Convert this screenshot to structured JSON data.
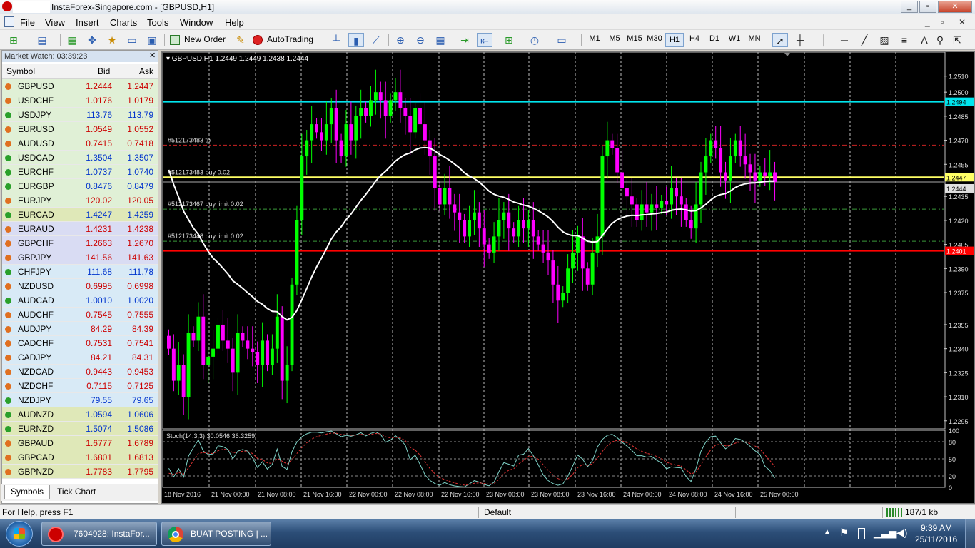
{
  "window": {
    "title": "InstaForex-Singapore.com - [GBPUSD,H1]"
  },
  "menu": [
    "File",
    "View",
    "Insert",
    "Charts",
    "Tools",
    "Window",
    "Help"
  ],
  "toolbar": {
    "new_order": "New Order",
    "autotrading": "AutoTrading",
    "timeframes": [
      "M1",
      "M5",
      "M15",
      "M30",
      "H1",
      "H4",
      "D1",
      "W1",
      "MN"
    ],
    "active_tf": "H1",
    "text_tool": "A"
  },
  "market_watch": {
    "title": "Market Watch: 03:39:23",
    "col_symbol": "Symbol",
    "col_bid": "Bid",
    "col_ask": "Ask",
    "rows": [
      {
        "symbol": "GBPUSD",
        "bid": "1.2444",
        "ask": "1.2447",
        "dir": "down",
        "color": "#cc0000",
        "bg": "#e0f0d6"
      },
      {
        "symbol": "USDCHF",
        "bid": "1.0176",
        "ask": "1.0179",
        "dir": "down",
        "color": "#cc0000",
        "bg": "#e0f0d6"
      },
      {
        "symbol": "USDJPY",
        "bid": "113.76",
        "ask": "113.79",
        "dir": "up",
        "color": "#0033cc",
        "bg": "#e0f0d6"
      },
      {
        "symbol": "EURUSD",
        "bid": "1.0549",
        "ask": "1.0552",
        "dir": "down",
        "color": "#cc0000",
        "bg": "#e0f0d6"
      },
      {
        "symbol": "AUDUSD",
        "bid": "0.7415",
        "ask": "0.7418",
        "dir": "down",
        "color": "#cc0000",
        "bg": "#e0f0d6"
      },
      {
        "symbol": "USDCAD",
        "bid": "1.3504",
        "ask": "1.3507",
        "dir": "up",
        "color": "#0033cc",
        "bg": "#e0f0d6"
      },
      {
        "symbol": "EURCHF",
        "bid": "1.0737",
        "ask": "1.0740",
        "dir": "up",
        "color": "#0033cc",
        "bg": "#e0f0d6"
      },
      {
        "symbol": "EURGBP",
        "bid": "0.8476",
        "ask": "0.8479",
        "dir": "up",
        "color": "#0033cc",
        "bg": "#e0f0d6"
      },
      {
        "symbol": "EURJPY",
        "bid": "120.02",
        "ask": "120.05",
        "dir": "down",
        "color": "#cc0000",
        "bg": "#e0f0d6"
      },
      {
        "symbol": "EURCAD",
        "bid": "1.4247",
        "ask": "1.4259",
        "dir": "up",
        "color": "#0033cc",
        "bg": "#dfe8b8"
      },
      {
        "symbol": "EURAUD",
        "bid": "1.4231",
        "ask": "1.4238",
        "dir": "down",
        "color": "#cc0000",
        "bg": "#d9dcf3"
      },
      {
        "symbol": "GBPCHF",
        "bid": "1.2663",
        "ask": "1.2670",
        "dir": "down",
        "color": "#cc0000",
        "bg": "#d9dcf3"
      },
      {
        "symbol": "GBPJPY",
        "bid": "141.56",
        "ask": "141.63",
        "dir": "down",
        "color": "#cc0000",
        "bg": "#d9dcf3"
      },
      {
        "symbol": "CHFJPY",
        "bid": "111.68",
        "ask": "111.78",
        "dir": "up",
        "color": "#0033cc",
        "bg": "#d8eaf6"
      },
      {
        "symbol": "NZDUSD",
        "bid": "0.6995",
        "ask": "0.6998",
        "dir": "down",
        "color": "#cc0000",
        "bg": "#d8eaf6"
      },
      {
        "symbol": "AUDCAD",
        "bid": "1.0010",
        "ask": "1.0020",
        "dir": "up",
        "color": "#0033cc",
        "bg": "#d8eaf6"
      },
      {
        "symbol": "AUDCHF",
        "bid": "0.7545",
        "ask": "0.7555",
        "dir": "down",
        "color": "#cc0000",
        "bg": "#d8eaf6"
      },
      {
        "symbol": "AUDJPY",
        "bid": "84.29",
        "ask": "84.39",
        "dir": "down",
        "color": "#cc0000",
        "bg": "#d8eaf6"
      },
      {
        "symbol": "CADCHF",
        "bid": "0.7531",
        "ask": "0.7541",
        "dir": "down",
        "color": "#cc0000",
        "bg": "#d8eaf6"
      },
      {
        "symbol": "CADJPY",
        "bid": "84.21",
        "ask": "84.31",
        "dir": "down",
        "color": "#cc0000",
        "bg": "#d8eaf6"
      },
      {
        "symbol": "NZDCAD",
        "bid": "0.9443",
        "ask": "0.9453",
        "dir": "down",
        "color": "#cc0000",
        "bg": "#d8eaf6"
      },
      {
        "symbol": "NZDCHF",
        "bid": "0.7115",
        "ask": "0.7125",
        "dir": "down",
        "color": "#cc0000",
        "bg": "#d8eaf6"
      },
      {
        "symbol": "NZDJPY",
        "bid": "79.55",
        "ask": "79.65",
        "dir": "up",
        "color": "#0033cc",
        "bg": "#d8eaf6"
      },
      {
        "symbol": "AUDNZD",
        "bid": "1.0594",
        "ask": "1.0606",
        "dir": "up",
        "color": "#0033cc",
        "bg": "#dfe8b8"
      },
      {
        "symbol": "EURNZD",
        "bid": "1.5074",
        "ask": "1.5086",
        "dir": "up",
        "color": "#0033cc",
        "bg": "#dfe8b8"
      },
      {
        "symbol": "GBPAUD",
        "bid": "1.6777",
        "ask": "1.6789",
        "dir": "down",
        "color": "#cc0000",
        "bg": "#dfe8b8"
      },
      {
        "symbol": "GBPCAD",
        "bid": "1.6801",
        "ask": "1.6813",
        "dir": "down",
        "color": "#cc0000",
        "bg": "#dfe8b8"
      },
      {
        "symbol": "GBPNZD",
        "bid": "1.7783",
        "ask": "1.7795",
        "dir": "down",
        "color": "#cc0000",
        "bg": "#dfe8b8"
      }
    ],
    "tab_symbols": "Symbols",
    "tab_tick": "Tick Chart"
  },
  "chart": {
    "header": "GBPUSD,H1  1.2449 1.2449 1.2438 1.2444",
    "ylim": [
      1.229,
      1.2525
    ],
    "price_ticks": [
      "1.2510",
      "1.2500",
      "1.2485",
      "1.2470",
      "1.2455",
      "1.2435",
      "1.2420",
      "1.2405",
      "1.2390",
      "1.2375",
      "1.2355",
      "1.2340",
      "1.2325",
      "1.2310",
      "1.2295"
    ],
    "hline_cyan": {
      "price": 1.2494,
      "label": "1.2494"
    },
    "hline_red": {
      "price": 1.2401,
      "label": "1.2401"
    },
    "ask_line": {
      "price": 1.2447,
      "label": "1.2447"
    },
    "bid_line": {
      "price": 1.2444,
      "label": "1.2444"
    },
    "orders": [
      {
        "label": "#512173483 tp",
        "price": 1.2467
      },
      {
        "label": "#512173483 buy 0.02",
        "price": 1.2447
      },
      {
        "label": "#512173467 buy limit 0.02",
        "price": 1.2427
      },
      {
        "label": "#512173448 buy limit 0.02",
        "price": 1.2407
      }
    ],
    "time_labels": [
      "18 Nov 2016",
      "21 Nov 00:00",
      "21 Nov 08:00",
      "21 Nov 16:00",
      "22 Nov 00:00",
      "22 Nov 08:00",
      "22 Nov 16:00",
      "23 Nov 00:00",
      "23 Nov 08:00",
      "23 Nov 16:00",
      "24 Nov 00:00",
      "24 Nov 08:00",
      "24 Nov 16:00",
      "25 Nov 00:00"
    ],
    "indicator": {
      "label": "Stoch(14,3,3) 30.0546 36.3259",
      "levels": [
        "100",
        "80",
        "50",
        "20",
        "0"
      ]
    },
    "colors": {
      "bull": "#00ff00",
      "bear": "#ff00ff",
      "ma": "#ffffff",
      "cyan": "#00e5ee",
      "red": "#ff0000",
      "order": "#ffff66"
    }
  },
  "chart_data": {
    "type": "candlestick",
    "symbol": "GBPUSD",
    "timeframe": "H1",
    "ylim": [
      1.229,
      1.2525
    ],
    "close": [
      1.234,
      1.232,
      1.233,
      1.231,
      1.235,
      1.2345,
      1.236,
      1.233,
      1.2335,
      1.234,
      1.2355,
      1.2345,
      1.234,
      1.2325,
      1.235,
      1.2345,
      1.234,
      1.2338,
      1.233,
      1.2345,
      1.233,
      1.234,
      1.236,
      1.232,
      1.233,
      1.238,
      1.242,
      1.246,
      1.247,
      1.248,
      1.2475,
      1.247,
      1.248,
      1.249,
      1.247,
      1.246,
      1.248,
      1.247,
      1.2485,
      1.249,
      1.2485,
      1.2495,
      1.25,
      1.2495,
      1.2485,
      1.2495,
      1.25,
      1.249,
      1.2485,
      1.2475,
      1.249,
      1.248,
      1.247,
      1.246,
      1.244,
      1.243,
      1.244,
      1.243,
      1.2425,
      1.242,
      1.241,
      1.242,
      1.2425,
      1.2415,
      1.2405,
      1.24,
      1.241,
      1.242,
      1.2425,
      1.2415,
      1.241,
      1.242,
      1.2415,
      1.242,
      1.241,
      1.2405,
      1.24,
      1.2395,
      1.238,
      1.237,
      1.2375,
      1.239,
      1.24,
      1.241,
      1.239,
      1.238,
      1.24,
      1.241,
      1.246,
      1.247,
      1.2465,
      1.245,
      1.244,
      1.2435,
      1.243,
      1.242,
      1.243,
      1.2425,
      1.243,
      1.2428,
      1.2432,
      1.243,
      1.244,
      1.2435,
      1.243,
      1.242,
      1.2415,
      1.243,
      1.245,
      1.246,
      1.247,
      1.2465,
      1.245,
      1.2445,
      1.246,
      1.247,
      1.246,
      1.2455,
      1.245,
      1.2445,
      1.245,
      1.2448,
      1.245,
      1.2444
    ]
  },
  "status": {
    "help": "For Help, press F1",
    "profile": "Default",
    "traffic": "187/1 kb"
  },
  "taskbar": {
    "task1": "7604928: InstaFor...",
    "task2": "BUAT POSTING | ...",
    "time": "9:39 AM",
    "date": "25/11/2016"
  }
}
